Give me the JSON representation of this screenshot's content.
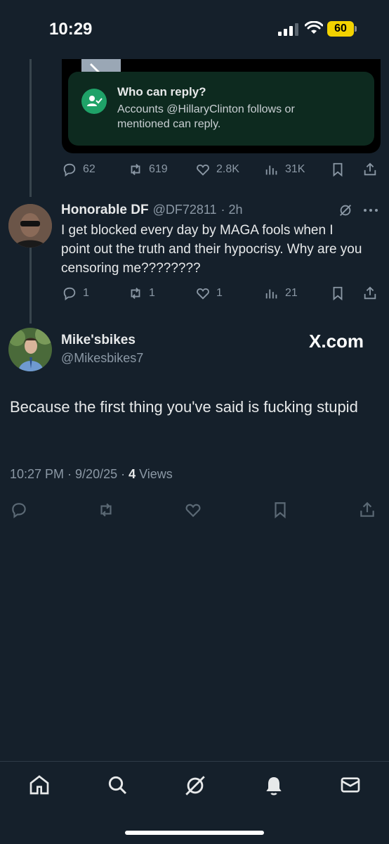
{
  "status_bar": {
    "time": "10:29",
    "battery": "60"
  },
  "quoted_post": {
    "reply_restriction_title": "Who can reply?",
    "reply_restriction_text": "Accounts @HillaryClinton follows or mentioned can reply.",
    "stats": {
      "replies": "62",
      "reposts": "619",
      "likes": "2.8K",
      "views": "31K"
    }
  },
  "reply_post": {
    "author_name": "Honorable DF",
    "author_handle": "@DF72811",
    "time_ago": "· 2h",
    "text": "I get blocked every day by MAGA fools when I point out the truth and their hypocrisy.  Why are you censoring me????????",
    "stats": {
      "replies": "1",
      "reposts": "1",
      "likes": "1",
      "views": "21"
    }
  },
  "main_post": {
    "author_name": "Mike'sbikes",
    "author_handle": "@Mikesbikes7",
    "watermark": "X.com",
    "text": "Because the first thing you've said is fucking stupid",
    "timestamp": "10:27 PM · 9/20/25 · ",
    "views_count": "4",
    "views_label": " Views"
  },
  "bottom_nav": [
    "home",
    "search",
    "grok",
    "notifications",
    "messages"
  ],
  "colors": {
    "background": "#15202b",
    "text": "#e7e9ea",
    "muted": "#8b98a5",
    "green": "#1fa268"
  }
}
